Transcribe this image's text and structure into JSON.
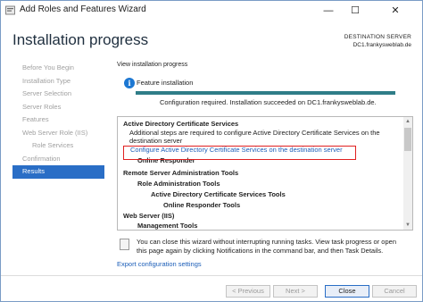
{
  "window": {
    "title": "Add Roles and Features Wizard",
    "controls": {
      "minimize": "—",
      "maximize": "☐",
      "close": "✕"
    }
  },
  "header": {
    "page_title": "Installation progress",
    "destination_label": "DESTINATION SERVER",
    "destination_name": "DC1.frankysweblab.de"
  },
  "nav": {
    "items": [
      {
        "label": "Before You Begin",
        "state": "disabled",
        "sub": false
      },
      {
        "label": "Installation Type",
        "state": "disabled",
        "sub": false
      },
      {
        "label": "Server Selection",
        "state": "disabled",
        "sub": false
      },
      {
        "label": "Server Roles",
        "state": "disabled",
        "sub": false
      },
      {
        "label": "Features",
        "state": "disabled",
        "sub": false
      },
      {
        "label": "Web Server Role (IIS)",
        "state": "disabled",
        "sub": false
      },
      {
        "label": "Role Services",
        "state": "disabled",
        "sub": true
      },
      {
        "label": "Confirmation",
        "state": "disabled",
        "sub": false
      },
      {
        "label": "Results",
        "state": "active",
        "sub": false
      }
    ]
  },
  "main": {
    "view_label": "View installation progress",
    "status_icon": "info-icon",
    "feature_label": "Feature installation",
    "progress": 1.0,
    "progress_message": "Configuration required. Installation succeeded on DC1.frankysweblab.de.",
    "results": {
      "adcs_heading": "Active Directory Certificate Services",
      "adcs_message_1": "Additional steps are required to configure Active Directory Certificate Services on the",
      "adcs_message_2": "destination server",
      "configure_link": "Configure Active Directory Certificate Services on the destination server",
      "online_responder": "Online Responder",
      "rsat_heading": "Remote Server Administration Tools",
      "role_admin_tools": "Role Administration Tools",
      "adcs_tools": "Active Directory Certificate Services Tools",
      "online_responder_tools": "Online Responder Tools",
      "web_server_heading": "Web Server (IIS)",
      "management_tools": "Management Tools"
    },
    "note": "You can close this wizard without interrupting running tasks. View task progress or open this page again by clicking Notifications in the command bar, and then Task Details.",
    "export_link": "Export configuration settings"
  },
  "footer": {
    "previous": "< Previous",
    "next": "Next >",
    "close": "Close",
    "cancel": "Cancel"
  },
  "colors": {
    "accent": "#2a6ec6",
    "progress": "#2f7d88",
    "highlight": "#e02020",
    "link": "#1c5eb8"
  }
}
